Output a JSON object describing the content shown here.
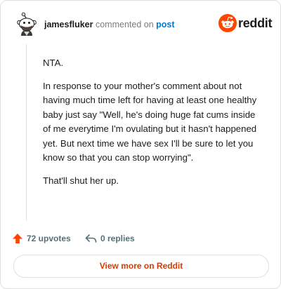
{
  "comment": {
    "username": "jamesfluker",
    "verb": "commented on",
    "post_link": "post",
    "paragraphs": [
      "NTA.",
      "In response to your mother's comment about not having much time left for having at least one healthy baby just say \"Well, he's doing huge fat cums inside of me everytime I'm ovulating but it hasn't happened yet. But next time we have sex I'll be sure to let you know so that you can stop worrying\".",
      "That'll shut her up."
    ]
  },
  "brand": {
    "wordmark": "reddit",
    "icon": "reddit-logo-icon",
    "color": "#ff4500"
  },
  "actions": {
    "upvotes_label": "72 upvotes",
    "upvote_icon": "upvote-arrow-icon",
    "upvote_color": "#ff4500",
    "replies_label": "0 replies",
    "reply_icon": "reply-arrow-icon"
  },
  "footer": {
    "view_more_label": "View more on Reddit"
  },
  "avatar": {
    "icon": "snoo-avatar-icon"
  }
}
